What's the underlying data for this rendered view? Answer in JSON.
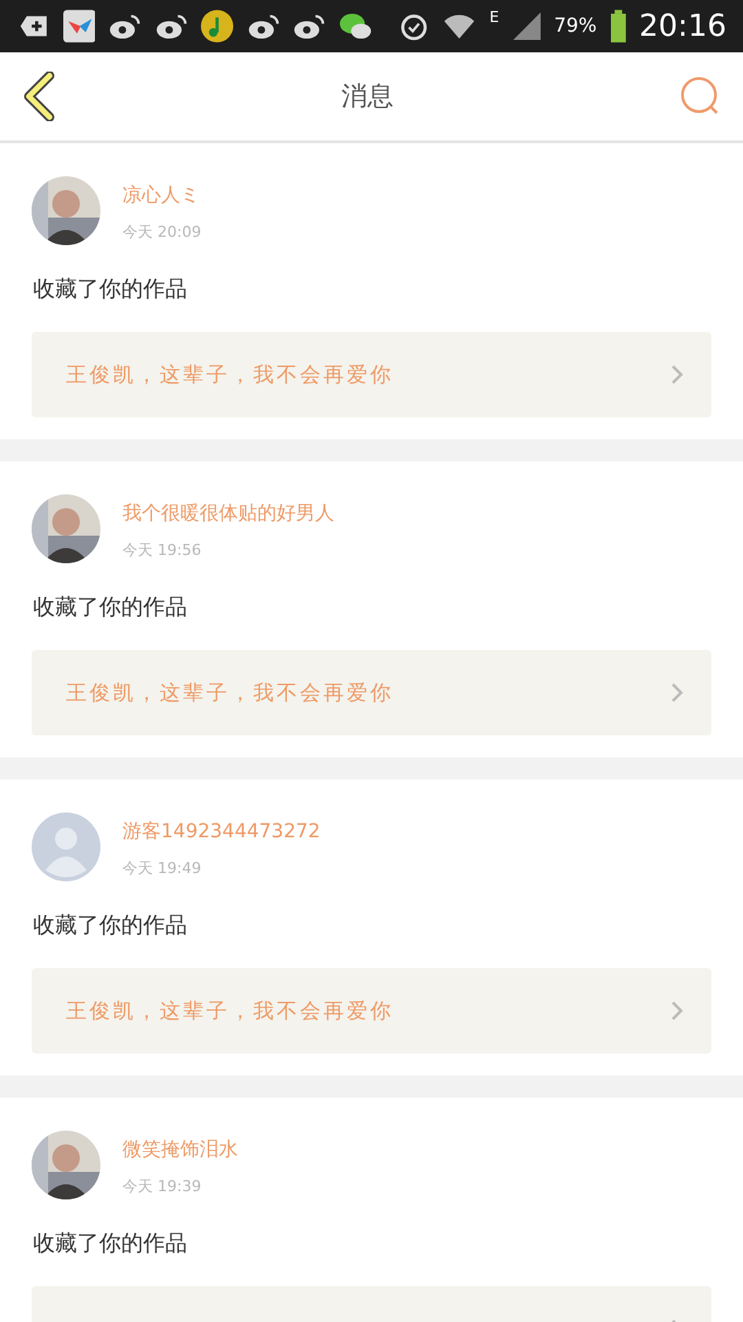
{
  "status_bar": {
    "network": "E",
    "battery": "79%",
    "time": "20:16"
  },
  "header": {
    "title": "消息"
  },
  "messages": [
    {
      "name": "凉心人ミ",
      "time": "今天 20:09",
      "action": "收藏了你的作品",
      "work": "王俊凯，这辈子，我不会再爱你"
    },
    {
      "name": "我个很暖很体贴的好男人",
      "time": "今天 19:56",
      "action": "收藏了你的作品",
      "work": "王俊凯，这辈子，我不会再爱你"
    },
    {
      "name": "游客1492344473272",
      "time": "今天 19:49",
      "action": "收藏了你的作品",
      "work": "王俊凯，这辈子，我不会再爱你",
      "avatar": {
        "kind": "default"
      }
    },
    {
      "name": "微笑掩饰泪水",
      "time": "今天 19:39",
      "action": "收藏了你的作品"
    }
  ]
}
